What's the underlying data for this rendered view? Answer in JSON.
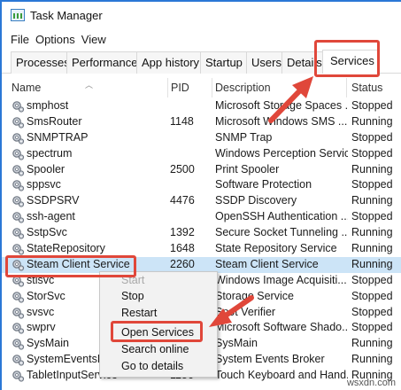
{
  "window": {
    "title": "Task Manager"
  },
  "menu": [
    "File",
    "Options",
    "View"
  ],
  "tabs": [
    "Processes",
    "Performance",
    "App history",
    "Startup",
    "Users",
    "Details",
    "Services"
  ],
  "active_tab": "Services",
  "columns": {
    "name": "Name",
    "pid": "PID",
    "description": "Description",
    "status": "Status"
  },
  "services": [
    {
      "name": "smphost",
      "pid": "",
      "description": "Microsoft Storage Spaces ...",
      "status": "Stopped"
    },
    {
      "name": "SmsRouter",
      "pid": "1148",
      "description": "Microsoft Windows SMS ...",
      "status": "Running"
    },
    {
      "name": "SNMPTRAP",
      "pid": "",
      "description": "SNMP Trap",
      "status": "Stopped"
    },
    {
      "name": "spectrum",
      "pid": "",
      "description": "Windows Perception Service",
      "status": "Stopped"
    },
    {
      "name": "Spooler",
      "pid": "2500",
      "description": "Print Spooler",
      "status": "Running"
    },
    {
      "name": "sppsvc",
      "pid": "",
      "description": "Software Protection",
      "status": "Stopped"
    },
    {
      "name": "SSDPSRV",
      "pid": "4476",
      "description": "SSDP Discovery",
      "status": "Running"
    },
    {
      "name": "ssh-agent",
      "pid": "",
      "description": "OpenSSH Authentication ...",
      "status": "Stopped"
    },
    {
      "name": "SstpSvc",
      "pid": "1392",
      "description": "Secure Socket Tunneling ...",
      "status": "Running"
    },
    {
      "name": "StateRepository",
      "pid": "1648",
      "description": "State Repository Service",
      "status": "Running"
    },
    {
      "name": "Steam Client Service",
      "pid": "2260",
      "description": "Steam Client Service",
      "status": "Running"
    },
    {
      "name": "stisvc",
      "pid": "",
      "description": "Windows Image Acquisiti...",
      "status": "Stopped"
    },
    {
      "name": "StorSvc",
      "pid": "",
      "description": "Storage Service",
      "status": "Stopped"
    },
    {
      "name": "svsvc",
      "pid": "",
      "description": "Spot Verifier",
      "status": "Stopped"
    },
    {
      "name": "swprv",
      "pid": "",
      "description": "Microsoft Software Shado...",
      "status": "Stopped"
    },
    {
      "name": "SysMain",
      "pid": "",
      "description": "SysMain",
      "status": "Running"
    },
    {
      "name": "SystemEventsBroker",
      "pid": "",
      "description": "System Events Broker",
      "status": "Running"
    },
    {
      "name": "TabletInputService",
      "pid": "1156",
      "description": "Touch Keyboard and Hand...",
      "status": "Running"
    }
  ],
  "selected_index": 10,
  "context_menu": {
    "items": [
      {
        "label": "Start",
        "enabled": false
      },
      {
        "label": "Stop",
        "enabled": true
      },
      {
        "label": "Restart",
        "enabled": true
      },
      {
        "label": "Open Services",
        "enabled": true
      },
      {
        "label": "Search online",
        "enabled": true
      },
      {
        "label": "Go to details",
        "enabled": true
      }
    ]
  },
  "watermark": "wsxdn.com",
  "colors": {
    "accent": "#2b78d6",
    "selection": "#cce4f7",
    "annotation_red": "#e0473a"
  }
}
